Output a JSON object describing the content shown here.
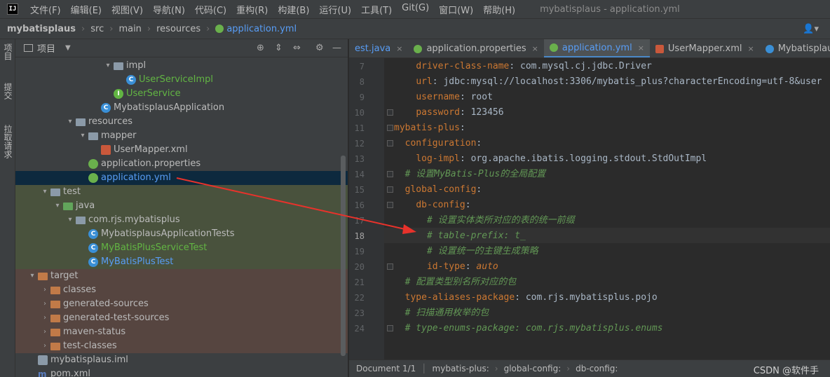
{
  "menubar": {
    "logo": "IJ",
    "items": [
      "文件(F)",
      "编辑(E)",
      "视图(V)",
      "导航(N)",
      "代码(C)",
      "重构(R)",
      "构建(B)",
      "运行(U)",
      "工具(T)",
      "Git(G)",
      "窗口(W)",
      "帮助(H)"
    ],
    "window_title": "mybatisplaus - application.yml"
  },
  "navbar": {
    "crumbs": [
      "mybatisplaus",
      "src",
      "main",
      "resources",
      "application.yml"
    ],
    "user_icon": "person-icon"
  },
  "left_strip": {
    "buttons": [
      "项目",
      "提交",
      "拉取请求"
    ]
  },
  "project_panel": {
    "title": "项目",
    "tree": [
      {
        "label": "impl",
        "depth": 7,
        "expanded": true,
        "icon": "folder",
        "color": "default"
      },
      {
        "label": "UserServiceImpl",
        "depth": 8,
        "icon": "class",
        "color": "green"
      },
      {
        "label": "UserService",
        "depth": 7,
        "icon": "interface",
        "color": "green"
      },
      {
        "label": "MybatisplausApplication",
        "depth": 6,
        "icon": "spring-class",
        "color": "default"
      },
      {
        "label": "resources",
        "depth": 4,
        "expanded": true,
        "icon": "resources-folder",
        "color": "default"
      },
      {
        "label": "mapper",
        "depth": 5,
        "expanded": true,
        "icon": "folder",
        "color": "default"
      },
      {
        "label": "UserMapper.xml",
        "depth": 6,
        "icon": "xml",
        "color": "default"
      },
      {
        "label": "application.properties",
        "depth": 5,
        "icon": "spring",
        "color": "default"
      },
      {
        "label": "application.yml",
        "depth": 5,
        "icon": "spring",
        "color": "blue",
        "selected": true
      },
      {
        "label": "test",
        "depth": 2,
        "expanded": true,
        "icon": "folder",
        "color": "default",
        "bg": "test"
      },
      {
        "label": "java",
        "depth": 3,
        "expanded": true,
        "icon": "folder-green",
        "color": "default",
        "bg": "test"
      },
      {
        "label": "com.rjs.mybatisplus",
        "depth": 4,
        "expanded": true,
        "icon": "package",
        "color": "default",
        "bg": "test"
      },
      {
        "label": "MybatisplausApplicationTests",
        "depth": 5,
        "icon": "class",
        "color": "default",
        "bg": "test"
      },
      {
        "label": "MyBatisPlusServiceTest",
        "depth": 5,
        "icon": "class",
        "color": "green",
        "bg": "test"
      },
      {
        "label": "MyBatisPlusTest",
        "depth": 5,
        "icon": "class",
        "color": "blue",
        "bg": "test"
      },
      {
        "label": "target",
        "depth": 1,
        "expanded": true,
        "icon": "folder-orange",
        "color": "default",
        "bg": "target"
      },
      {
        "label": "classes",
        "depth": 2,
        "expanded": false,
        "icon": "folder-orange",
        "color": "default",
        "bg": "target"
      },
      {
        "label": "generated-sources",
        "depth": 2,
        "expanded": false,
        "icon": "folder-orange",
        "color": "default",
        "bg": "target"
      },
      {
        "label": "generated-test-sources",
        "depth": 2,
        "expanded": false,
        "icon": "folder-orange",
        "color": "default",
        "bg": "target"
      },
      {
        "label": "maven-status",
        "depth": 2,
        "expanded": false,
        "icon": "folder-orange",
        "color": "default",
        "bg": "target"
      },
      {
        "label": "test-classes",
        "depth": 2,
        "expanded": false,
        "icon": "folder-orange",
        "color": "default",
        "bg": "target"
      },
      {
        "label": "mybatisplaus.iml",
        "depth": 1,
        "icon": "iml",
        "color": "default"
      },
      {
        "label": "pom.xml",
        "depth": 1,
        "icon": "maven",
        "color": "default"
      }
    ]
  },
  "editor": {
    "tabs": [
      {
        "label": "est.java",
        "active": false,
        "icon": "java"
      },
      {
        "label": "application.properties",
        "active": false,
        "icon": "spring"
      },
      {
        "label": "application.yml",
        "active": true,
        "icon": "spring"
      },
      {
        "label": "UserMapper.xml",
        "active": false,
        "icon": "xml"
      },
      {
        "label": "MybatisplausApplicati",
        "active": false,
        "icon": "spring-class"
      }
    ],
    "current_line": 18,
    "lines": [
      {
        "n": "7",
        "indent": "    ",
        "key": "driver-class-name",
        "val": "com.mysql.cj.jdbc.Driver"
      },
      {
        "n": "8",
        "indent": "    ",
        "key": "url",
        "val": "jdbc:mysql://localhost:3306/mybatis_plus?characterEncoding=utf-8&user"
      },
      {
        "n": "9",
        "indent": "    ",
        "key": "username",
        "val": "root"
      },
      {
        "n": "10",
        "indent": "    ",
        "key": "password",
        "val": "123456"
      },
      {
        "n": "11",
        "indent": "",
        "key": "mybatis-plus",
        "val": ""
      },
      {
        "n": "12",
        "indent": "  ",
        "key": "configuration",
        "val": ""
      },
      {
        "n": "13",
        "indent": "    ",
        "key": "log-impl",
        "val": "org.apache.ibatis.logging.stdout.StdOutImpl"
      },
      {
        "n": "14",
        "indent": "  ",
        "comment": "# 设置MyBatis-Plus的全局配置"
      },
      {
        "n": "15",
        "indent": "  ",
        "key": "global-config",
        "val": ""
      },
      {
        "n": "16",
        "indent": "    ",
        "key": "db-config",
        "val": ""
      },
      {
        "n": "17",
        "indent": "      ",
        "comment": "# 设置实体类所对应的表的统一前缀"
      },
      {
        "n": "18",
        "indent": "      ",
        "comment": "# table-prefix: t_"
      },
      {
        "n": "19",
        "indent": "      ",
        "comment": "# 设置统一的主键生成策略"
      },
      {
        "n": "20",
        "indent": "      ",
        "key": "id-type",
        "val": "auto",
        "val_keyword": true
      },
      {
        "n": "21",
        "indent": "  ",
        "comment": "# 配置类型别名所对应的包"
      },
      {
        "n": "22",
        "indent": "  ",
        "key": "type-aliases-package",
        "val": "com.rjs.mybatisplus.pojo"
      },
      {
        "n": "23",
        "indent": "  ",
        "comment": "# 扫描通用枚举的包"
      },
      {
        "n": "24",
        "indent": "  ",
        "comment": "# type-enums-package: com.rjs.mybatisplus.enums"
      }
    ]
  },
  "statusbar": {
    "items": [
      "Document 1/1",
      "mybatis-plus:",
      "global-config:",
      "db-config:"
    ],
    "watermark": "CSDN @软件手"
  },
  "colors": {
    "background": "#2b2b2b",
    "panel": "#3c3f41",
    "selection": "#0d293e",
    "yaml_key": "#cc7832",
    "comment": "#629755",
    "annotation_arrow": "#e8322b"
  }
}
